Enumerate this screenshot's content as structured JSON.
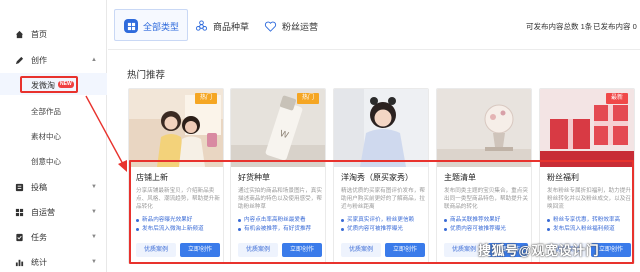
{
  "sidebar": {
    "items": [
      {
        "label": "首页",
        "icon": "home-icon",
        "chevron": ""
      },
      {
        "label": "创作",
        "icon": "create-icon",
        "chevron": "^"
      },
      {
        "label": "投稿",
        "icon": "submit-icon",
        "chevron": "v"
      },
      {
        "label": "自运营",
        "icon": "operation-icon",
        "chevron": "v"
      },
      {
        "label": "任务",
        "icon": "task-icon",
        "chevron": "v"
      },
      {
        "label": "统计",
        "icon": "stats-icon",
        "chevron": "v"
      }
    ],
    "sub_items": [
      "全部作品",
      "素材中心",
      "创意中心"
    ],
    "active_item": {
      "label": "发微淘",
      "badge": "NEW"
    }
  },
  "tabs": [
    {
      "label": "全部类型",
      "icon": "grid-icon"
    },
    {
      "label": "商品种草",
      "icon": "flower-icon"
    },
    {
      "label": "粉丝运营",
      "icon": "heart-icon"
    }
  ],
  "stats": {
    "total_label": "可发布内容总数",
    "total_value": "1条",
    "published_label": "已发布内容",
    "published_value": "0"
  },
  "section": {
    "title": "热门推荐"
  },
  "cards": [
    {
      "title": "店铺上新",
      "badge": "热门",
      "badge_color": "#f5a623",
      "desc": "分享店铺最新宝贝，介绍新品卖点、风格、潮流趋势，帮助提升新品转化",
      "features": [
        "新品内容曝光效果好",
        "发布后流入微淘上新频道"
      ],
      "btn_example": "优质案例",
      "btn_create": "立即创作"
    },
    {
      "title": "好货种草",
      "badge": "热门",
      "badge_color": "#f5a623",
      "desc": "通过实拍的商品和场景图片，真实描述商品的特色以及使用感受，帮助粉丝种草",
      "features": [
        "内容点击率高粉丝最爱看",
        "有机会被推荐，有好货推荐"
      ],
      "btn_example": "优质案例",
      "btn_create": "立即创作"
    },
    {
      "title": "洋淘秀（原买家秀）",
      "badge": "",
      "badge_color": "",
      "desc": "精选优质的买家有图评价发布，帮助用户购买前更好的了解商品，拉近与粉丝距离",
      "features": [
        "买家真实评价，粉丝更信赖",
        "优质内容可被推荐曝光"
      ],
      "btn_example": "优质案例",
      "btn_create": "立即创作"
    },
    {
      "title": "主题清单",
      "badge": "",
      "badge_color": "",
      "desc": "发布同类主题的宝贝集合，重点突出同一类型商品特色，帮助提升关联商品的转化",
      "features": [
        "商品关联推荐效果好",
        "优质内容可被推荐曝光"
      ],
      "btn_example": "优质案例",
      "btn_create": "立即创作"
    },
    {
      "title": "粉丝福利",
      "badge": "最新",
      "badge_color": "#f04848",
      "desc": "发布粉丝专属折扣福利，助力提升粉丝转化并以及粉丝成交，以及召唤回流",
      "features": [
        "粉丝专享优惠，转粉效率高",
        "发布后流入粉丝福利频道"
      ],
      "btn_example": "优质案例",
      "btn_create": "立即创作"
    }
  ],
  "watermark": "搜狐号@观宽设计门"
}
